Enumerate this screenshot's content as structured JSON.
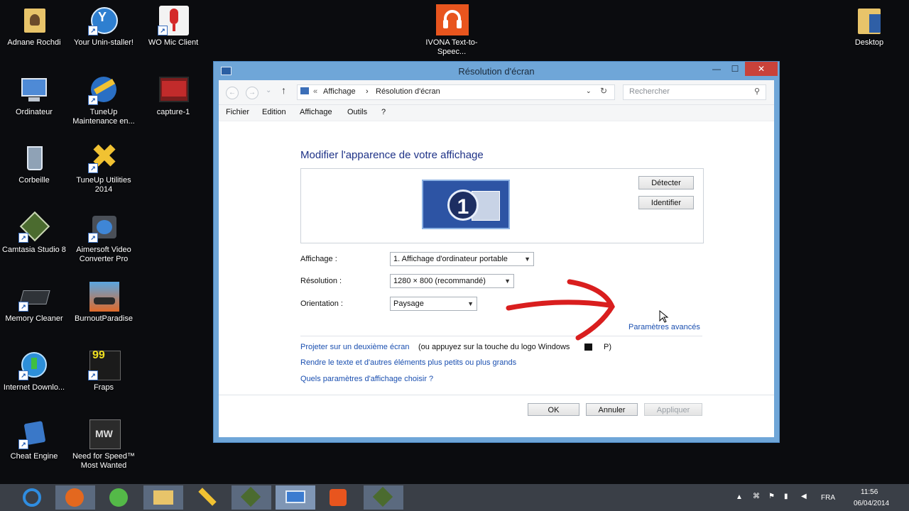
{
  "desktop": {
    "icons": [
      {
        "label": "Adnane Rochdi",
        "icon": "user-folder-icon"
      },
      {
        "label": "Your Unin-staller!",
        "icon": "uninstaller-icon"
      },
      {
        "label": "WO Mic Client",
        "icon": "microphone-icon"
      },
      {
        "label": "IVONA Text-to-Speec...",
        "icon": "headphones-icon"
      },
      {
        "label": "Desktop",
        "icon": "folder-icon"
      },
      {
        "label": "Ordinateur",
        "icon": "computer-icon"
      },
      {
        "label": "TuneUp Maintenance en...",
        "icon": "tuneup-icon"
      },
      {
        "label": "capture-1",
        "icon": "video-file-icon"
      },
      {
        "label": "Corbeille",
        "icon": "recycle-bin-icon"
      },
      {
        "label": "TuneUp Utilities 2014",
        "icon": "tuneup-utilities-icon"
      },
      {
        "label": "Camtasia Studio 8",
        "icon": "camtasia-icon"
      },
      {
        "label": "Aimersoft Video Converter Pro",
        "icon": "video-converter-icon"
      },
      {
        "label": "Memory Cleaner",
        "icon": "memory-cleaner-icon"
      },
      {
        "label": "BurnoutParadise",
        "icon": "game-icon"
      },
      {
        "label": "Internet Downlo...",
        "icon": "download-manager-icon"
      },
      {
        "label": "Fraps",
        "icon": "fraps-icon"
      },
      {
        "label": "Cheat Engine",
        "icon": "cheat-engine-icon"
      },
      {
        "label": "Need for Speed™ Most Wanted",
        "icon": "nfs-icon"
      }
    ]
  },
  "window": {
    "title": "Résolution d'écran",
    "controls": {
      "minimize": "—",
      "maximize": "☐",
      "close": "✕"
    },
    "breadcrumb": {
      "prefix": "«",
      "item1": "Affichage",
      "sep": "›",
      "item2": "Résolution d'écran"
    },
    "search_placeholder": "Rechercher",
    "menu": [
      "Fichier",
      "Edition",
      "Affichage",
      "Outils",
      "?"
    ],
    "heading": "Modifier l'apparence de votre affichage",
    "monitor_number": "1",
    "detect_label": "Détecter",
    "identify_label": "Identifier",
    "fields": {
      "display_label": "Affichage :",
      "display_value": "1. Affichage d'ordinateur portable",
      "resolution_label": "Résolution :",
      "resolution_value": "1280 × 800 (recommandé)",
      "orientation_label": "Orientation :",
      "orientation_value": "Paysage"
    },
    "advanced_link": "Paramètres avancés",
    "links": {
      "project": "Projeter sur un deuxième écran",
      "project_note": "(ou appuyez sur la touche du logo Windows",
      "project_key": "P)",
      "text_size": "Rendre le texte et d'autres éléments plus petits ou plus grands",
      "which_settings": "Quels paramètres d'affichage choisir ?"
    },
    "buttons": {
      "ok": "OK",
      "cancel": "Annuler",
      "apply": "Appliquer"
    }
  },
  "taskbar": {
    "apps": [
      "internet-explorer-icon",
      "firefox-icon",
      "utorrent-icon",
      "file-explorer-icon",
      "tuneup-icon",
      "camtasia-icon",
      "display-settings-icon",
      "media-player-icon",
      "camtasia-recorder-icon"
    ],
    "language": "FRA",
    "time": "11:56",
    "date": "06/04/2014"
  },
  "colors": {
    "annotation_arrow": "#d91e1e",
    "link": "#1a4fb0",
    "heading": "#1e3287"
  }
}
